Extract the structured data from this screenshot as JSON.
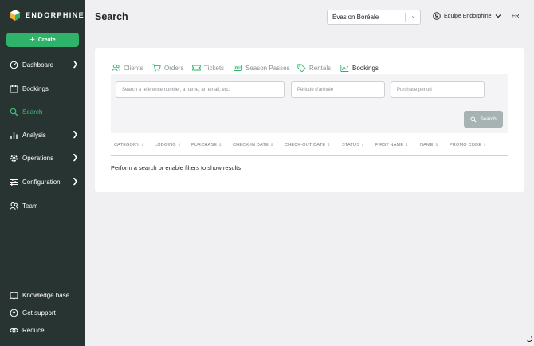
{
  "brand": {
    "name": "ENDORPHINE",
    "accent": "#2fb36a",
    "sidebar_bg": "#273431"
  },
  "sidebar": {
    "create_label": "Create",
    "items": [
      {
        "label": "Dashboard",
        "icon": "dashboard-icon",
        "has_submenu": true
      },
      {
        "label": "Bookings",
        "icon": "calendar-icon",
        "has_submenu": false
      },
      {
        "label": "Search",
        "icon": "search-icon",
        "has_submenu": false,
        "active": true
      },
      {
        "label": "Analysis",
        "icon": "bar-chart-icon",
        "has_submenu": true
      },
      {
        "label": "Operations",
        "icon": "gear-icon",
        "has_submenu": true
      },
      {
        "label": "Configuration",
        "icon": "sliders-icon",
        "has_submenu": true
      },
      {
        "label": "Team",
        "icon": "users-icon",
        "has_submenu": false
      }
    ],
    "footer": [
      {
        "label": "Knowledge base",
        "icon": "book-icon"
      },
      {
        "label": "Get support",
        "icon": "help-icon"
      },
      {
        "label": "Reduce",
        "icon": "eye-icon"
      }
    ]
  },
  "header": {
    "title": "Search",
    "venue": "Évasion Boréale",
    "team": "Équipe Endorphine",
    "language": "FR"
  },
  "tabs": [
    {
      "label": "Clients",
      "icon": "users-icon"
    },
    {
      "label": "Orders",
      "icon": "cart-icon"
    },
    {
      "label": "Tickets",
      "icon": "ticket-icon"
    },
    {
      "label": "Season Passes",
      "icon": "pass-icon"
    },
    {
      "label": "Rentals",
      "icon": "tag-icon"
    },
    {
      "label": "Bookings",
      "icon": "bookings-icon",
      "active": true
    }
  ],
  "filters": {
    "query_placeholder": "Search a reference number, a name, an email, etc.",
    "arrival_placeholder": "Période d'arrivée",
    "purchase_placeholder": "Purchase period",
    "search_label": "Search"
  },
  "table": {
    "columns": [
      "CATEGORY",
      "LODGING",
      "PURCHASE",
      "CHECK-IN DATE",
      "CHECK-OUT DATE",
      "STATUS",
      "FIRST NAME",
      "NAME",
      "PROMO CODE"
    ],
    "empty_message": "Perform a search or enable filters to show results"
  }
}
